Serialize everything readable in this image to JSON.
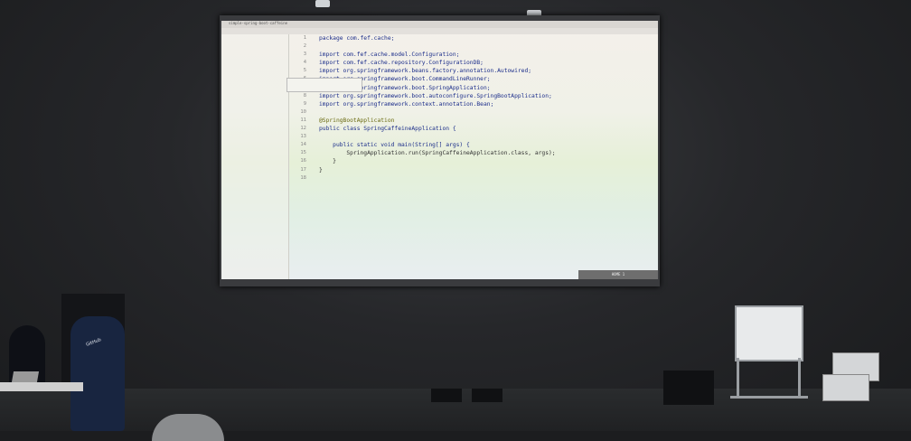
{
  "ide": {
    "title": "simple-spring-boot-caffeine",
    "code_lines": [
      "package com.fef.cache;",
      "",
      "import com.fef.cache.model.Configuration;",
      "import com.fef.cache.repository.ConfigurationDB;",
      "import org.springframework.beans.factory.annotation.Autowired;",
      "import org.springframework.boot.CommandLineRunner;",
      "import org.springframework.boot.SpringApplication;",
      "import org.springframework.boot.autoconfigure.SpringBootApplication;",
      "import org.springframework.context.annotation.Bean;",
      "",
      "@SpringBootApplication",
      "public class SpringCaffeineApplication {",
      "",
      "    public static void main(String[] args) {",
      "        SpringApplication.run(SpringCaffeineApplication.class, args);",
      "    }",
      "}",
      ""
    ],
    "line_numbers": [
      "1",
      "2",
      "3",
      "4",
      "5",
      "6",
      "7",
      "8",
      "9",
      "10",
      "11",
      "12",
      "13",
      "14",
      "15",
      "16",
      "17",
      "18"
    ],
    "status_text": "HOME 1"
  },
  "shirt_text": "GitHub"
}
